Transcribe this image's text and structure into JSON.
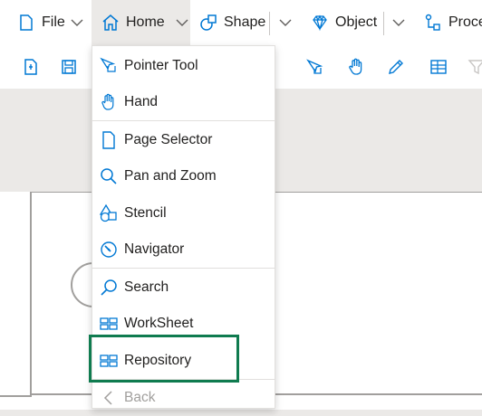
{
  "menubar": {
    "items": [
      {
        "label": "File",
        "icon": "file-icon"
      },
      {
        "label": "Home",
        "icon": "home-icon"
      },
      {
        "label": "Shape",
        "icon": "shape-icon"
      },
      {
        "label": "Object",
        "icon": "object-icon"
      },
      {
        "label": "Proce",
        "icon": "process-icon"
      }
    ]
  },
  "toolbar": {
    "icons": [
      "export-icon",
      "save-icon",
      "pointer-tool-icon",
      "hand-icon",
      "pen-icon",
      "worksheet-icon",
      "filter-icon"
    ]
  },
  "home_menu": {
    "items": [
      {
        "label": "Pointer Tool",
        "icon": "pointer-tool-icon"
      },
      {
        "label": "Hand",
        "icon": "hand-icon"
      },
      {
        "label": "Page Selector",
        "icon": "page-icon"
      },
      {
        "label": "Pan and Zoom",
        "icon": "magnifier-icon"
      },
      {
        "label": "Stencil",
        "icon": "stencil-icon"
      },
      {
        "label": "Navigator",
        "icon": "compass-icon"
      },
      {
        "label": "Search",
        "icon": "search-icon"
      },
      {
        "label": "WorkSheet",
        "icon": "worksheet-icon"
      },
      {
        "label": "Repository",
        "icon": "repository-icon"
      },
      {
        "label": "Back",
        "icon": "chevron-left-icon"
      }
    ]
  },
  "colors": {
    "accent": "#0078d4",
    "highlight_border": "#0f7b4f",
    "background": "#ebe9e7"
  }
}
